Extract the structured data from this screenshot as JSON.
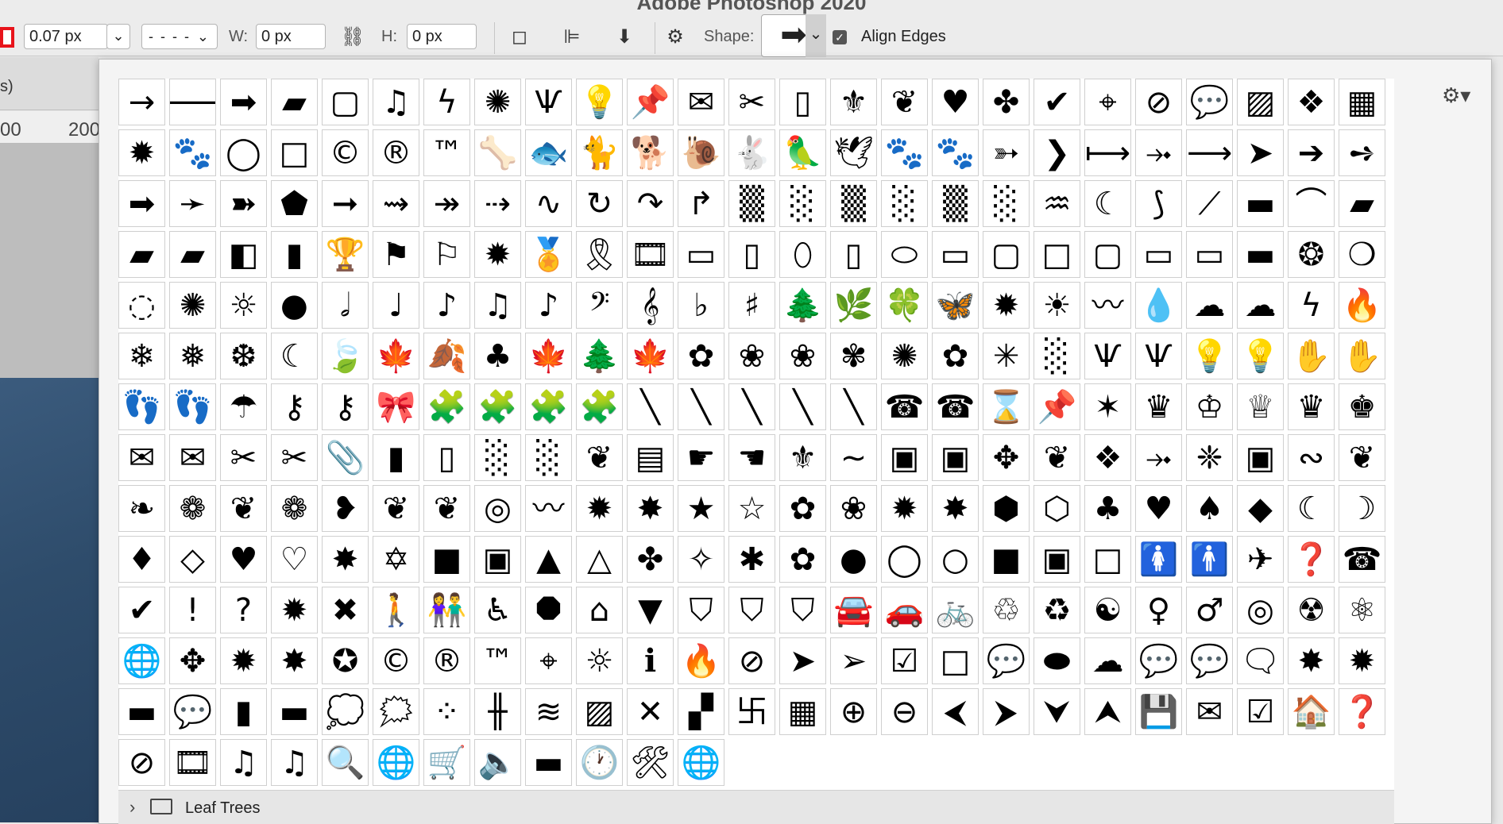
{
  "app": {
    "title": "Adobe Photoshop 2020"
  },
  "options_bar": {
    "stroke_width": "0.07 px",
    "stroke_type": "- - - -",
    "w_label": "W:",
    "w_value": "0 px",
    "h_label": "H:",
    "h_value": "0 px",
    "shape_label": "Shape:",
    "align_edges_label": "Align Edges",
    "align_edges_checked": true,
    "stroke_color": "#e8141b"
  },
  "document": {
    "tab_fragment": "s)",
    "ruler_labels": [
      "00",
      "200"
    ]
  },
  "shape_picker": {
    "rows": [
      [
        "→",
        "🡒",
        "➡",
        "▰",
        "▢",
        "♫",
        "ϟ",
        "✺",
        "Ѱ",
        "💡",
        "📌",
        "✉",
        "✂",
        "▯",
        "⚜",
        "❦",
        "♥",
        "✤",
        "✔",
        "⌖",
        "⊘",
        "💬",
        "▨",
        "❖",
        "▦"
      ],
      [
        "✹",
        "🐾",
        "◯",
        "□",
        "©",
        "®",
        "™",
        "🦴",
        "🐟",
        "🐈",
        "🐕",
        "🐌",
        "🐇",
        "🦜",
        "🕊",
        "🐾",
        "🐾",
        "➳",
        "❯",
        "⟼",
        "⤞",
        "⟶",
        "➤",
        "➔",
        "➺"
      ],
      [
        "➡",
        "➛",
        "➽",
        "⬟",
        "➞",
        "⇝",
        "↠",
        "⇢",
        "∿",
        "↻",
        "↷",
        "↱",
        "▒",
        "░",
        "▒",
        "░",
        "▒",
        "░",
        "♒",
        "☾",
        "⟆",
        "⟋",
        "▬",
        "⌒",
        "▰"
      ],
      [
        "▰",
        "▰",
        "◧",
        "▮",
        "🏆",
        "⚑",
        "⚐",
        "✹",
        "🏅",
        "🎗",
        "🎞",
        "▭",
        "▯",
        "⬯",
        "▯",
        "⬭",
        "▭",
        "▢",
        "□",
        "▢",
        "▭",
        "▭",
        "▬",
        "❂",
        "❍"
      ],
      [
        "◌",
        "✺",
        "☼",
        "●",
        "𝅗𝅥",
        "♩",
        "♪",
        "♫",
        "♪",
        "𝄢",
        "𝄞",
        "♭",
        "♯",
        "🌲",
        "🌿",
        "🍀",
        "🦋",
        "✹",
        "☀",
        "〰",
        "💧",
        "☁",
        "☁",
        "ϟ",
        "🔥"
      ],
      [
        "❄",
        "❅",
        "❆",
        "☾",
        "🍃",
        "🍁",
        "🍂",
        "♣",
        "🍁",
        "🌲",
        "🍁",
        "✿",
        "❀",
        "❀",
        "✾",
        "✺",
        "✿",
        "✳",
        "░",
        "Ѱ",
        "Ѱ",
        "💡",
        "💡",
        "✋",
        "✋"
      ],
      [
        "👣",
        "👣",
        "☂",
        "⚷",
        "⚷",
        "🎀",
        "🧩",
        "🧩",
        "🧩",
        "🧩",
        "╲",
        "╲",
        "╲",
        "╲",
        "╲",
        "☎",
        "☎",
        "⌛",
        "📌",
        "✶",
        "♛",
        "♔",
        "♕",
        "♛",
        "♚"
      ],
      [
        "✉",
        "✉",
        "✂",
        "✂",
        "📎",
        "▮",
        "▯",
        "░",
        "░",
        "❦",
        "▤",
        "☛",
        "☚",
        "⚜",
        "∼",
        "▣",
        "▣",
        "✥",
        "❦",
        "❖",
        "⤞",
        "❈",
        "▣",
        "∾",
        "❦"
      ],
      [
        "❧",
        "❁",
        "❦",
        "❁",
        "❥",
        "❦",
        "❦",
        "◎",
        "〰",
        "✹",
        "✸",
        "★",
        "☆",
        "✿",
        "❀",
        "✹",
        "✸",
        "⬢",
        "⬡",
        "♣",
        "♥",
        "♠",
        "◆",
        "☾",
        "☽"
      ],
      [
        "♦",
        "◇",
        "♥",
        "♡",
        "✸",
        "✡",
        "■",
        "▣",
        "▲",
        "△",
        "✤",
        "✧",
        "✱",
        "✿",
        "●",
        "◯",
        "○",
        "■",
        "▣",
        "□",
        "🚺",
        "🚹",
        "✈",
        "❓",
        "☎"
      ],
      [
        "✔",
        "!",
        "?",
        "✹",
        "✖",
        "🚶",
        "👫",
        "♿",
        "⯃",
        "⌂",
        "▼",
        "⛉",
        "⛉",
        "⛉",
        "🚘",
        "🚗",
        "🚲",
        "♲",
        "♻",
        "☯",
        "♀",
        "♂",
        "◎",
        "☢",
        "⚛"
      ],
      [
        "🌐",
        "✥",
        "✹",
        "✸",
        "✪",
        "©",
        "®",
        "™",
        "⌖",
        "☼",
        "ℹ",
        "🔥",
        "⊘",
        "➤",
        "➢",
        "☑",
        "□",
        "💬",
        "⬬",
        "☁",
        "💬",
        "💬",
        "🗨",
        "✸",
        "✹"
      ],
      [
        "▬",
        "💬",
        "▮",
        "▬",
        "💭",
        "🗯",
        "⁘",
        "╫",
        "≋",
        "▨",
        "✕",
        "▞",
        "卐",
        "▦",
        "⊕",
        "⊖",
        "⮜",
        "⮞",
        "⮟",
        "⮝",
        "💾",
        "✉",
        "☑",
        "🏠",
        "❓"
      ],
      [
        "⊘",
        "🎞",
        "♫",
        "♫",
        "🔍",
        "🌐",
        "🛒",
        "🔈",
        "▬",
        "🕐",
        "🛠",
        "🌐"
      ]
    ],
    "folder_label": "Leaf Trees"
  }
}
